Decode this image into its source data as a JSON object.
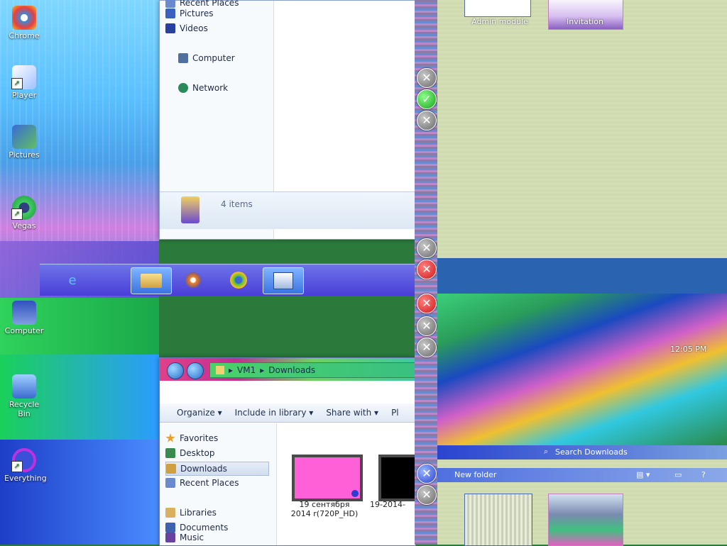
{
  "desktop": {
    "icons": [
      {
        "label": "Chrome"
      },
      {
        "label": "Player"
      },
      {
        "label": "Pictures"
      },
      {
        "label": "Vegas"
      },
      {
        "label": "Computer"
      },
      {
        "label": "Recycle Bin"
      },
      {
        "label": "Everything"
      }
    ]
  },
  "window_top": {
    "nav": [
      "Recent Places",
      "Pictures",
      "Videos",
      "Computer",
      "Network"
    ],
    "status": "4 items"
  },
  "window_bottom": {
    "breadcrumb": [
      "VM1",
      "Downloads"
    ],
    "toolbar": [
      "Organize",
      "Include in library",
      "Share with",
      "Pl"
    ],
    "nav": [
      "Favorites",
      "Desktop",
      "Downloads",
      "Recent Places",
      "Libraries",
      "Documents",
      "Music"
    ],
    "files": [
      {
        "name": "19 сентября 2014 r(720P_HD)",
        "color": "#ff60d8"
      },
      {
        "name": "19-2014-",
        "color": "#000000"
      }
    ]
  },
  "right_panel": {
    "top_captions": [
      "Admin module",
      "Invitation"
    ],
    "search": "Search Downloads",
    "new_folder": "New folder",
    "time": "12:05 PM"
  },
  "taskbar": {
    "buttons": [
      "folder",
      "media player",
      "chrome",
      "explorer"
    ]
  }
}
